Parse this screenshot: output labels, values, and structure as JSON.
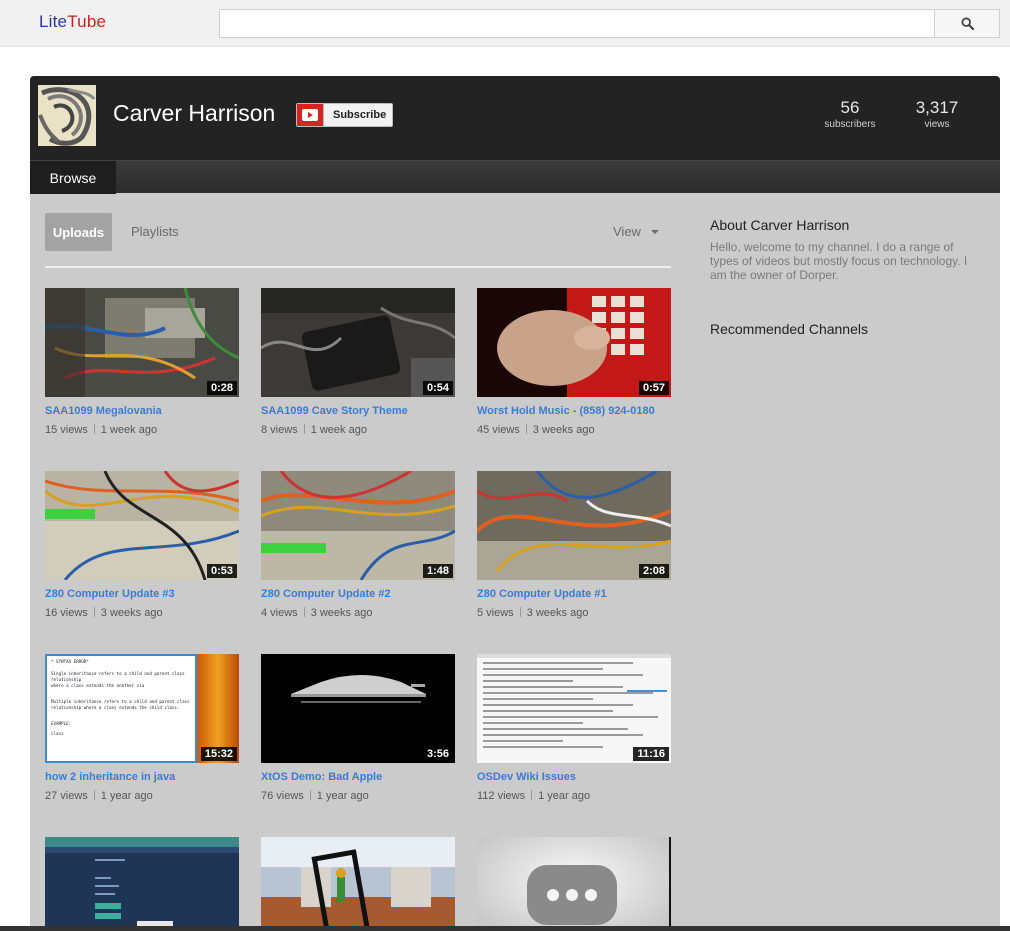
{
  "app": {
    "logo_lite": "Lite",
    "logo_tube": "Tube"
  },
  "search": {
    "placeholder": "",
    "button_icon": "search-icon"
  },
  "channel": {
    "name": "Carver Harrison",
    "subscribe_label": "Subscribe",
    "subscribers": "56",
    "subscribers_label": "subscribers",
    "views": "3,317",
    "views_label": "views"
  },
  "nav": {
    "browse": "Browse"
  },
  "tabs": {
    "uploads": "Uploads",
    "playlists": "Playlists",
    "view": "View"
  },
  "videos": [
    {
      "title": "SAA1099 Megalovania",
      "duration": "0:28",
      "views": "15 views",
      "age": "1 week ago"
    },
    {
      "title": "SAA1099 Cave Story Theme",
      "duration": "0:54",
      "views": "8 views",
      "age": "1 week ago"
    },
    {
      "title": "Worst Hold Music - (858) 924-0180",
      "duration": "0:57",
      "views": "45 views",
      "age": "3 weeks ago"
    },
    {
      "title": "Z80 Computer Update #3",
      "duration": "0:53",
      "views": "16 views",
      "age": "3 weeks ago"
    },
    {
      "title": "Z80 Computer Update #2",
      "duration": "1:48",
      "views": "4 views",
      "age": "3 weeks ago"
    },
    {
      "title": "Z80 Computer Update #1",
      "duration": "2:08",
      "views": "5 views",
      "age": "3 weeks ago"
    },
    {
      "title": "how 2 inheritance in java",
      "duration": "15:32",
      "views": "27 views",
      "age": "1 year ago"
    },
    {
      "title": "XtOS Demo: Bad Apple",
      "duration": "3:56",
      "views": "76 views",
      "age": "1 year ago"
    },
    {
      "title": "OSDev Wiki Issues",
      "duration": "11:16",
      "views": "112 views",
      "age": "1 year ago"
    }
  ],
  "thumb_text": {
    "java_lines": [
      "* SYNTAX ERROR*",
      "Single inheritance refers to a child and parent class relationship",
      "where a class extends the another cla",
      "Multiple inheritance refers to a child and parent class",
      "relationship where a class extends the child class.",
      "EXAMPLE:",
      "class"
    ]
  },
  "about": {
    "title": "About Carver Harrison",
    "text": "Hello, welcome to my channel. I do a range of types of videos but mostly focus on technology. I am the owner of Dorper."
  },
  "recommended": {
    "title": "Recommended Channels"
  },
  "colors": {
    "accent_link": "#3b7bd4",
    "subscribe_red": "#d32323",
    "header_dark": "#232323"
  }
}
